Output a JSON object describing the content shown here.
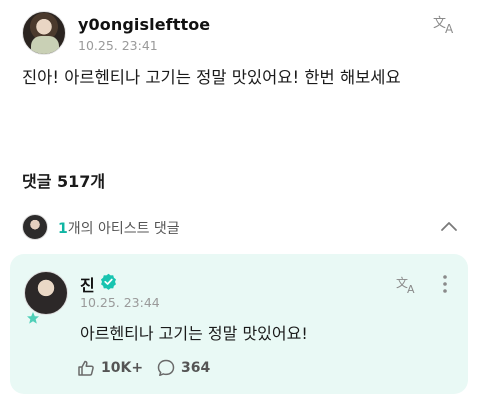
{
  "post": {
    "author": "y0ongislefttoe",
    "timestamp": "10.25. 23:41",
    "body": "진아! 아르헨티나 고기는 정말 맛있어요! 한번 해보세요"
  },
  "comments": {
    "label": "댓글",
    "count": "517개"
  },
  "artist_comments": {
    "count": "1",
    "label": "개의 아티스트 댓글"
  },
  "reply": {
    "author": "진",
    "timestamp": "10.25. 23:44",
    "body": "아르헨티나 고기는 정말 맛있어요!",
    "likes": "10K+",
    "replies": "364"
  },
  "colors": {
    "accent": "#0fb5a3",
    "card_bg": "#e9f9f5",
    "verified": "#18c4b0"
  },
  "icons": {
    "translate": "translate-icon",
    "more": "more-vertical-icon",
    "chevron": "chevron-up-icon",
    "like": "like-icon",
    "comment": "comment-icon",
    "verified": "verified-icon",
    "star": "star-badge-icon"
  }
}
